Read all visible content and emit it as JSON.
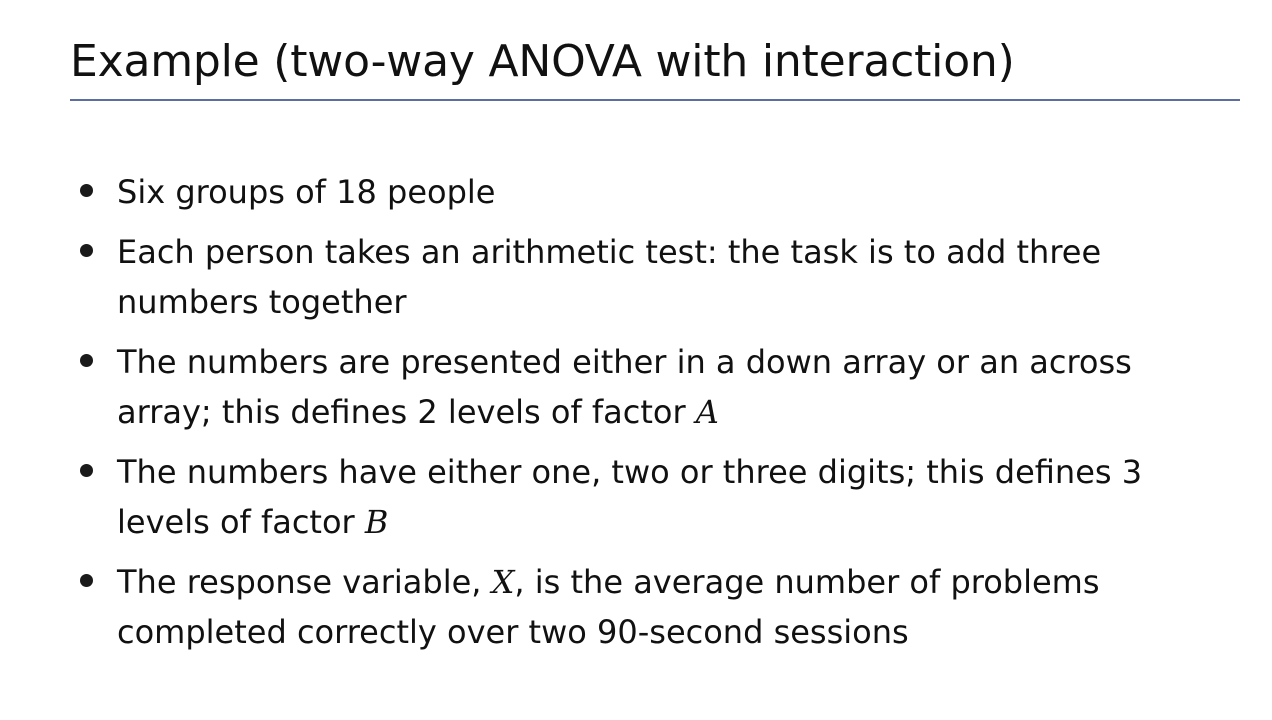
{
  "slide": {
    "title": "Example (two-way ANOVA with interaction)",
    "accent_color": "#5a6ea0",
    "bullets": [
      {
        "lines": [
          "Six groups of 18 people"
        ]
      },
      {
        "lines": [
          "Each person takes an arithmetic test: the task is to add three",
          "numbers together"
        ]
      },
      {
        "lines": [
          "The numbers are presented either in a down array or an across"
        ],
        "line2_text": "array; this defines 2 levels of factor ",
        "line2_var": "A"
      },
      {
        "lines": [
          "The numbers have either one, two or three digits; this defines 3"
        ],
        "line2_text": "levels of factor ",
        "line2_var": "B"
      },
      {
        "line1_pre": "The response variable, ",
        "line1_var": "X",
        "line1_post": ", is the average number of problems",
        "lines": [
          "completed correctly over two 90-second sessions"
        ]
      }
    ]
  }
}
